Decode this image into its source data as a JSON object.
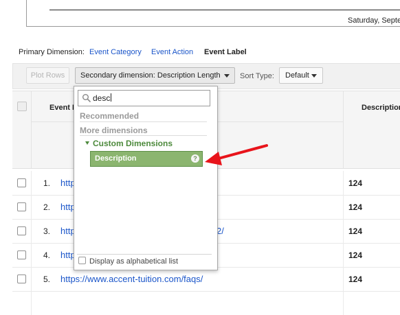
{
  "chart": {
    "date_label": "Saturday, Septe"
  },
  "primary_dimension": {
    "label": "Primary Dimension:",
    "options": [
      {
        "label": "Event Category",
        "active": false
      },
      {
        "label": "Event Action",
        "active": false
      },
      {
        "label": "Event Label",
        "active": true
      }
    ]
  },
  "toolbar": {
    "plot_rows": "Plot Rows",
    "secondary_dimension": "Secondary dimension: Description Length",
    "sort_type_label": "Sort Type:",
    "sort_type_value": "Default"
  },
  "table": {
    "columns": [
      "Event L",
      "Description"
    ],
    "rows": [
      {
        "num": "1.",
        "url": "http",
        "value": "124"
      },
      {
        "num": "2.",
        "url": "http",
        "value": "124"
      },
      {
        "num": "3.",
        "url": "http",
        "url_tail": "2/",
        "value": "124"
      },
      {
        "num": "4.",
        "url": "http",
        "value": "124"
      },
      {
        "num": "5.",
        "url": "https://www.accent-tuition.com/faqs/",
        "value": "124"
      }
    ]
  },
  "dropdown": {
    "search_value": "desc",
    "recommended": "Recommended",
    "more_dimensions": "More dimensions",
    "category": "Custom Dimensions",
    "highlighted_item": "Description",
    "help_glyph": "?",
    "alphabetical": "Display as alphabetical list"
  },
  "colors": {
    "link": "#1a55c9",
    "highlight_green": "#8bb56f",
    "category_green": "#4d8a3c",
    "annotation_arrow": "#e8141b"
  },
  "icons": [
    "search-icon",
    "help-icon",
    "caret-down-icon",
    "annotation-arrow-icon"
  ]
}
